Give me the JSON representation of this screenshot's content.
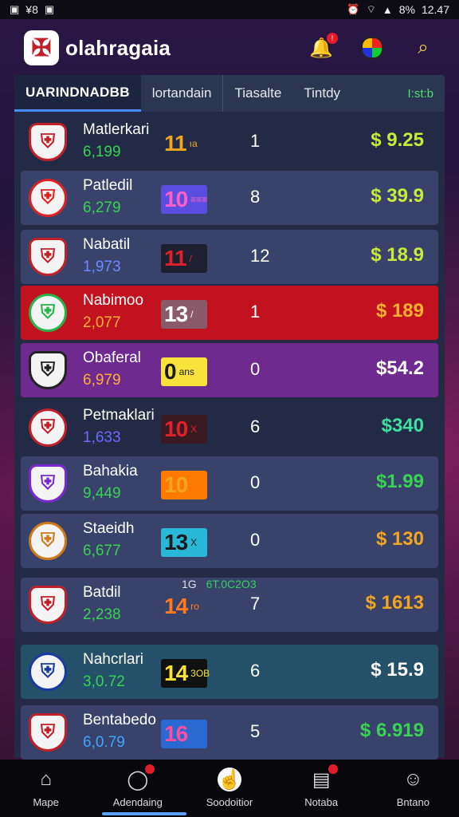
{
  "statusbar": {
    "left_a": "¥8",
    "signal": "8%",
    "time": "12.47"
  },
  "header": {
    "title": "olahragaia"
  },
  "tabs": [
    {
      "label": "UARINDNADBB"
    },
    {
      "label": "lortandain"
    },
    {
      "label": "Tiasalte"
    },
    {
      "label": "Tintdy"
    },
    {
      "label": "I:st:b"
    }
  ],
  "rows": [
    {
      "name": "Matlerkari",
      "count": "6,199",
      "count_color": "#39d353",
      "odds": "11",
      "odds_sub": "ıa",
      "odds_style": "num",
      "odds_color": "#f2a51e",
      "rank": "1",
      "price": "$ 9.25",
      "price_color": "#c6ec3a",
      "row_bg": "transparent",
      "crest_color": "#c0202a"
    },
    {
      "name": "Patledil",
      "count": "6,279",
      "count_color": "#39d353",
      "odds": "10",
      "odds_sub": "≡≡≡",
      "odds_style": "box",
      "odds_color": "#ff5ec4",
      "odds_bg": "#5a4de0",
      "rank": "8",
      "price": "$ 39.9",
      "price_color": "#c6ec3a",
      "row_bg": "#39426b",
      "crest_color": "#d22"
    },
    {
      "name": "Nabatil",
      "count": "1,973",
      "count_color": "#6b8cff",
      "odds": "11",
      "odds_sub": "/",
      "odds_style": "box",
      "odds_color": "#e0202a",
      "odds_bg": "#1e2032",
      "rank": "12",
      "price": "$ 18.9",
      "price_color": "#c6ec3a",
      "row_bg": "#39426b",
      "crest_color": "#c0202a"
    },
    {
      "name": "Nabimoo",
      "count": "2,077",
      "count_color": "#ffb030",
      "odds": "13",
      "odds_sub": "/",
      "odds_style": "box",
      "odds_color": "#ffffff",
      "odds_bg": "#8a5a6a",
      "rank": "1",
      "price": "$ 189",
      "price_color": "#ffb030",
      "row_bg": "#c2121f",
      "crest_color": "#2ab34a"
    },
    {
      "name": "Obaferal",
      "count": "6,979",
      "count_color": "#ffb030",
      "odds": "0",
      "odds_sub": "ans",
      "odds_style": "box",
      "odds_color": "#1a1a1a",
      "odds_bg": "#f7e33a",
      "rank": "0",
      "price": "$54.2",
      "price_color": "#ffffff",
      "row_bg": "#6e2a8f",
      "crest_color": "#222"
    },
    {
      "name": "Petmaklari",
      "count": "1,633",
      "count_color": "#6b6bff",
      "odds": "10",
      "odds_sub": "X",
      "odds_style": "box",
      "odds_color": "#e0202a",
      "odds_bg": "#3a1a22",
      "rank": "6",
      "price": "$340",
      "price_color": "#3ee0a0",
      "row_bg": "transparent",
      "crest_color": "#c0202a"
    },
    {
      "name": "Bahakia",
      "count": "9,449",
      "count_color": "#39d353",
      "odds": "10",
      "odds_sub": "",
      "odds_style": "box",
      "odds_color": "#f2a51e",
      "odds_bg": "#ff7a00",
      "rank": "0",
      "price": "$1.99",
      "price_color": "#39d353",
      "row_bg": "#39426b",
      "crest_color": "#7a2ad0"
    },
    {
      "name": "Staeidh",
      "count": "6,677",
      "count_color": "#39d353",
      "odds": "13",
      "odds_sub": "X",
      "odds_style": "box",
      "odds_color": "#1a1a1a",
      "odds_bg": "#2ab8d8",
      "rank": "0",
      "price": "$ 130",
      "price_color": "#f2a51e",
      "row_bg": "#39426b",
      "crest_color": "#d07a1a"
    },
    {
      "name": "Batdil",
      "count": "2,238",
      "count_color": "#39d353",
      "odds": "14",
      "odds_sub": "ro",
      "odds_style": "num",
      "odds_color": "#ff7a1a",
      "rank": "7",
      "price": "$ 1613",
      "price_color": "#f2a51e",
      "row_bg": "#39426b",
      "crest_color": "#c0202a"
    },
    {
      "name": "Nahcrlari",
      "count": "3,0.72",
      "count_color": "#39d353",
      "odds": "14",
      "odds_sub": "3OB",
      "odds_style": "box",
      "odds_color": "#f7e33a",
      "odds_bg": "#111",
      "rank": "6",
      "price": "$ 15.9",
      "price_color": "#ffffff",
      "row_bg": "#25506a",
      "crest_color": "#1a3aa0"
    },
    {
      "name": "Bentabedo",
      "count": "6,0.79",
      "count_color": "#3aa8ff",
      "odds": "16",
      "odds_sub": "",
      "odds_style": "box",
      "odds_color": "#ff4ea0",
      "odds_bg": "#2a6ad0",
      "rank": "5",
      "price": "$ 6.919",
      "price_color": "#39d353",
      "row_bg": "#39426b",
      "crest_color": "#c0202a"
    }
  ],
  "divider": {
    "left": "1G",
    "right": "6T.0C2O3"
  },
  "nav": [
    {
      "label": "Mape",
      "icon": "home-icon"
    },
    {
      "label": "Adendaing",
      "icon": "circle-icon"
    },
    {
      "label": "Soodoitior",
      "icon": "swipe-icon"
    },
    {
      "label": "Notaba",
      "icon": "chart-icon"
    },
    {
      "label": "Bntano",
      "icon": "profile-icon"
    }
  ]
}
